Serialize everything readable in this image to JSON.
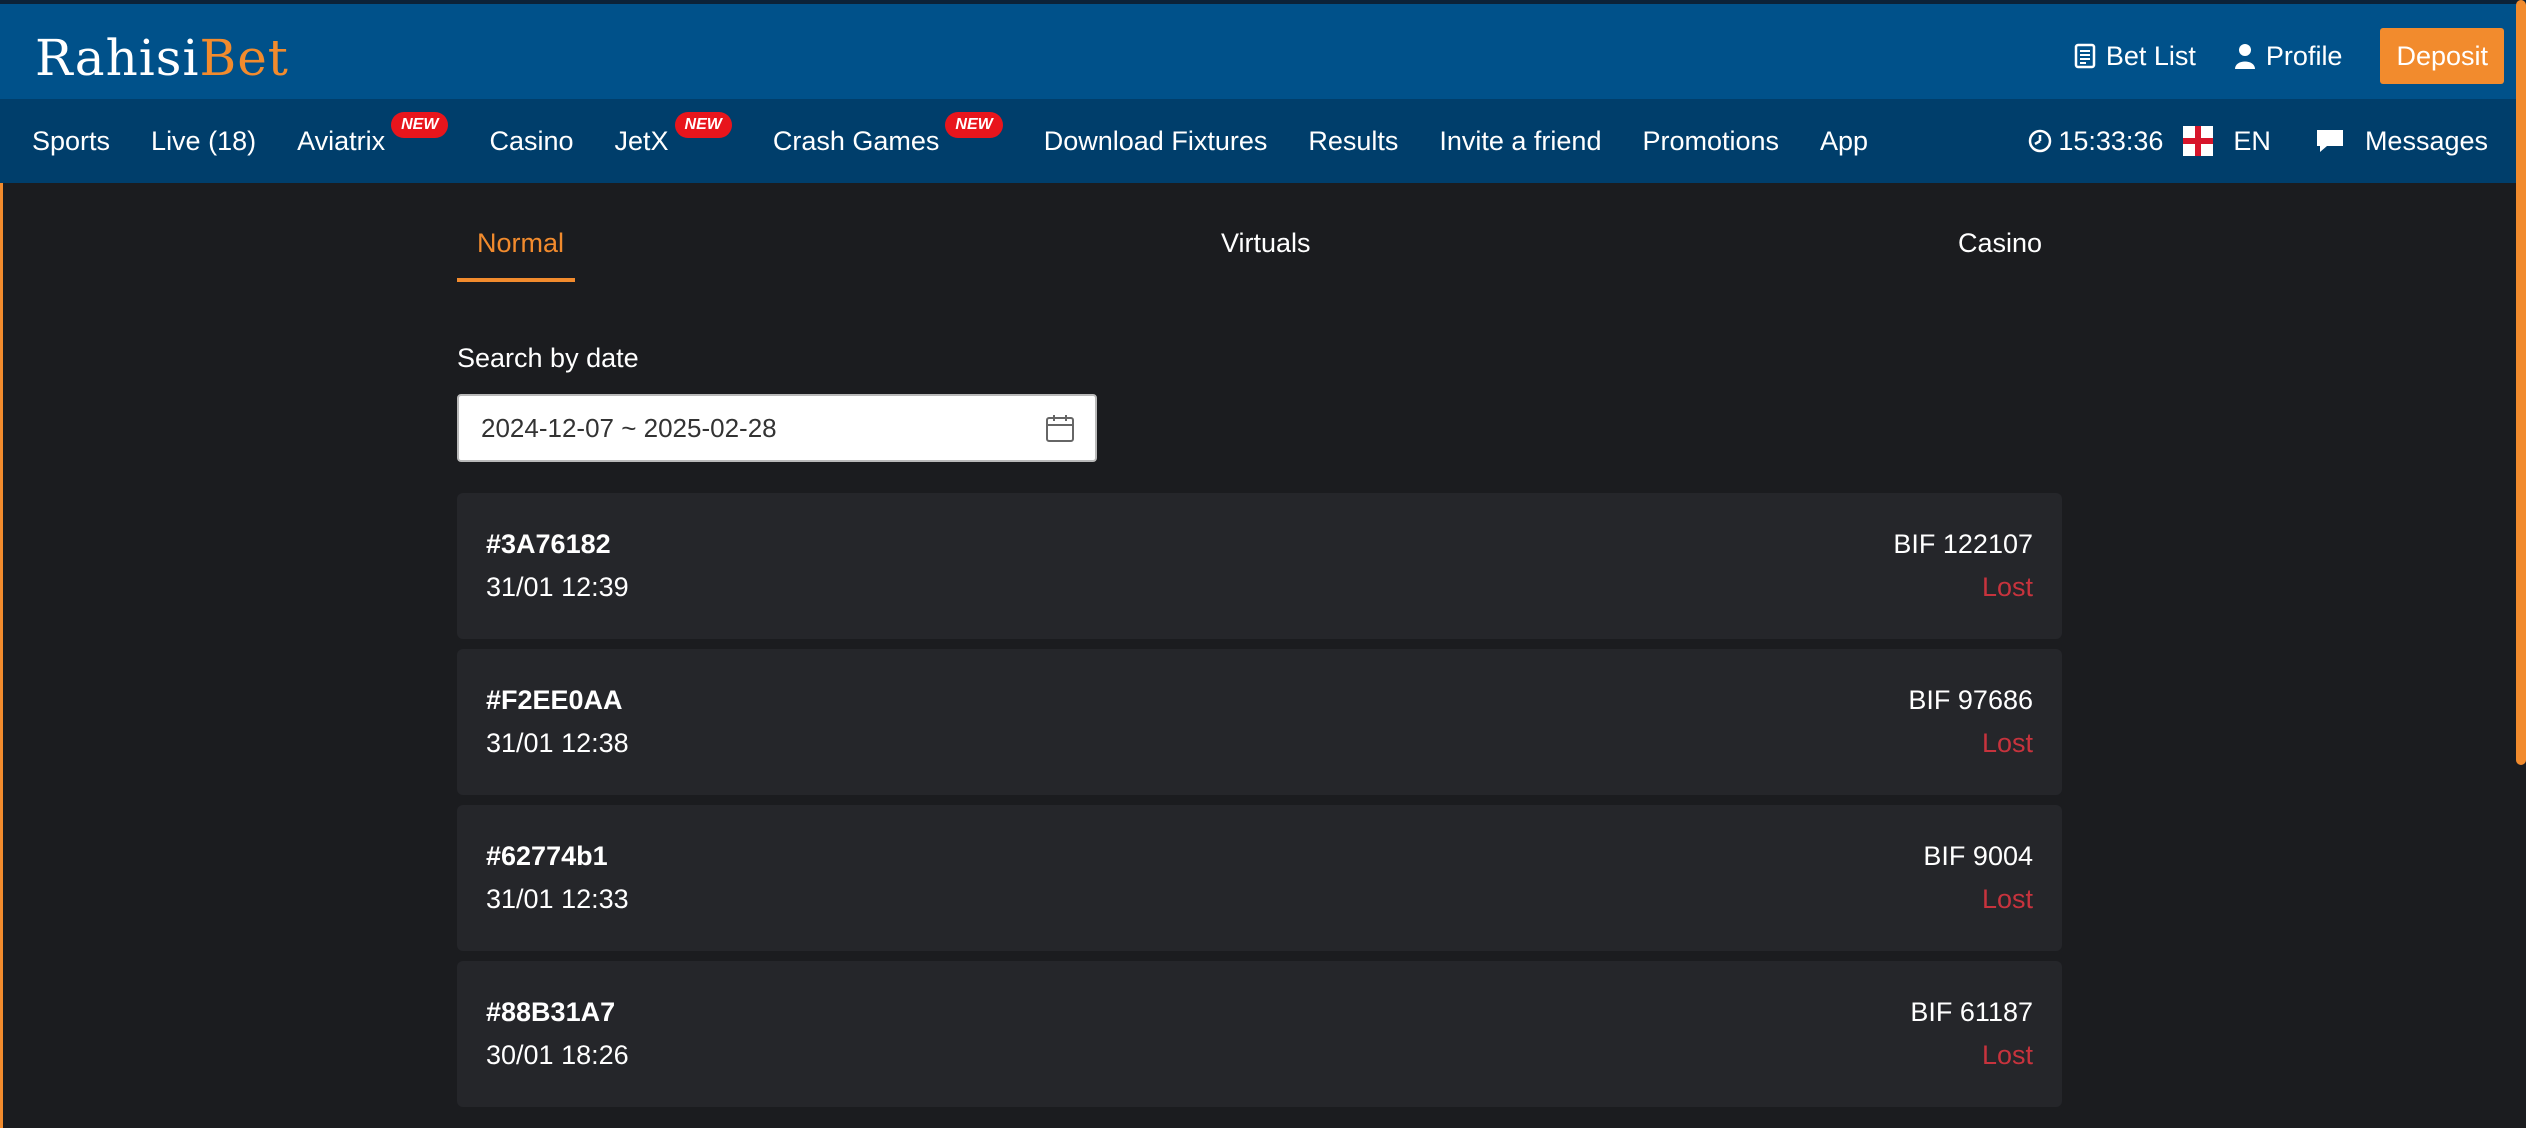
{
  "header": {
    "logo_part1": "Rahisi",
    "logo_part2": "Bet",
    "bet_list_label": "Bet List",
    "profile_label": "Profile",
    "deposit_label": "Deposit"
  },
  "nav": {
    "items": [
      {
        "label": "Sports",
        "badge": ""
      },
      {
        "label": "Live (18)",
        "badge": ""
      },
      {
        "label": "Aviatrix",
        "badge": "NEW"
      },
      {
        "label": "Casino",
        "badge": ""
      },
      {
        "label": "JetX",
        "badge": "NEW"
      },
      {
        "label": "Crash Games",
        "badge": "NEW"
      },
      {
        "label": "Download Fixtures",
        "badge": ""
      },
      {
        "label": "Results",
        "badge": ""
      },
      {
        "label": "Invite a friend",
        "badge": ""
      },
      {
        "label": "Promotions",
        "badge": ""
      },
      {
        "label": "App",
        "badge": ""
      }
    ],
    "time": "15:33:36",
    "language": "EN",
    "messages_label": "Messages"
  },
  "tabs": [
    {
      "label": "Normal",
      "active": true
    },
    {
      "label": "Virtuals",
      "active": false
    },
    {
      "label": "Casino",
      "active": false
    }
  ],
  "search": {
    "label": "Search by date",
    "date_range": "2024-12-07 ~ 2025-02-28"
  },
  "bets": [
    {
      "id": "#3A76182",
      "date": "31/01 12:39",
      "amount": "BIF 122107",
      "status": "Lost"
    },
    {
      "id": "#F2EE0AA",
      "date": "31/01 12:38",
      "amount": "BIF 97686",
      "status": "Lost"
    },
    {
      "id": "#62774b1",
      "date": "31/01 12:33",
      "amount": "BIF 9004",
      "status": "Lost"
    },
    {
      "id": "#88B31A7",
      "date": "30/01 18:26",
      "amount": "BIF 61187",
      "status": "Lost"
    }
  ],
  "colors": {
    "brand_blue": "#00518a",
    "nav_blue": "#003e6b",
    "accent_orange": "#f28b2d",
    "lost_red": "#c7333d",
    "background": "#1b1c1f",
    "card": "#25262a"
  }
}
